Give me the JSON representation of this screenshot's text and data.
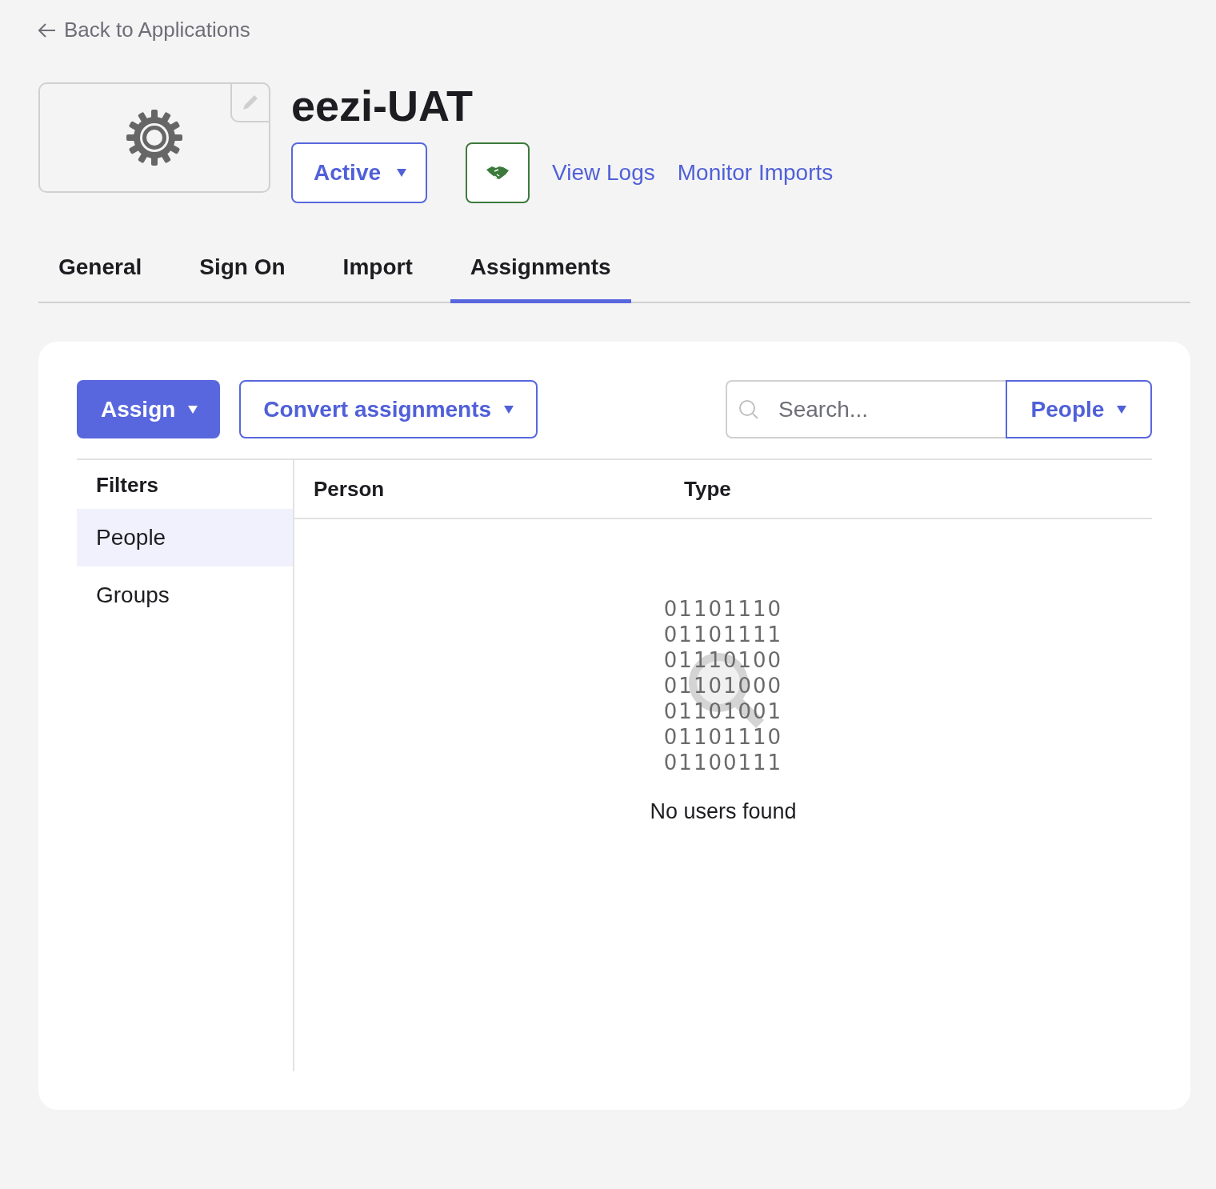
{
  "back_link": "Back to Applications",
  "app": {
    "title": "eezi-UAT",
    "status": "Active",
    "links": [
      "View Logs",
      "Monitor Imports"
    ]
  },
  "tabs": [
    {
      "label": "General",
      "selected": false
    },
    {
      "label": "Sign On",
      "selected": false
    },
    {
      "label": "Import",
      "selected": false
    },
    {
      "label": "Assignments",
      "selected": true
    }
  ],
  "toolbar": {
    "assign": "Assign",
    "convert": "Convert assignments",
    "search": {
      "placeholder": "Search..."
    },
    "filter_select": "People"
  },
  "filters": {
    "title": "Filters",
    "items": [
      {
        "label": "People",
        "selected": true
      },
      {
        "label": "Groups",
        "selected": false
      }
    ]
  },
  "table": {
    "columns": [
      "Person",
      "Type"
    ]
  },
  "empty_state": {
    "binary": [
      "01101110",
      "01101111",
      "01110100",
      "01101000",
      "01101001",
      "01101110",
      "01100111"
    ],
    "message": "No users found"
  }
}
